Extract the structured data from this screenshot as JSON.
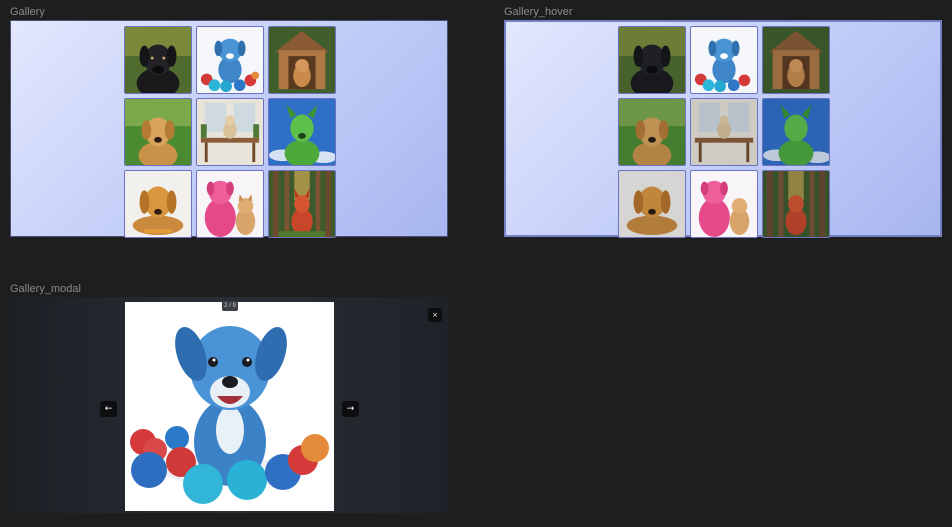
{
  "frames": {
    "gallery": {
      "label": "Gallery"
    },
    "hover": {
      "label": "Gallery_hover"
    },
    "modal": {
      "label": "Gallery_modal"
    }
  },
  "gallery": {
    "images": [
      {
        "name": "black-labrador"
      },
      {
        "name": "blue-puppy-with-balls"
      },
      {
        "name": "dog-in-wooden-doghouse"
      },
      {
        "name": "golden-retriever-in-field"
      },
      {
        "name": "dog-on-table-in-room"
      },
      {
        "name": "green-dog-blue-sky"
      },
      {
        "name": "golden-puppy-lying"
      },
      {
        "name": "pink-dog-and-cat"
      },
      {
        "name": "fox-in-forest"
      }
    ]
  },
  "modal": {
    "counter": "2 / 9",
    "prev_label": "←",
    "next_label": "→",
    "close_label": "×",
    "current_image": "blue-puppy-with-balls"
  }
}
